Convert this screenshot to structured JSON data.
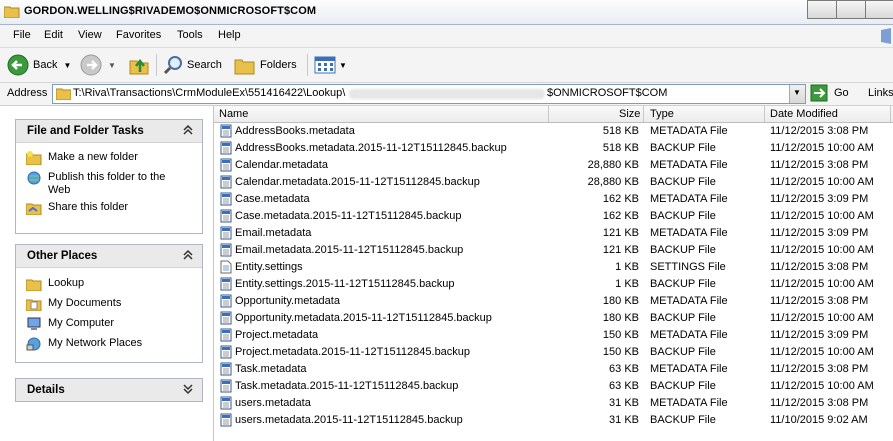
{
  "window": {
    "title": "GORDON.WELLING$RIVADEMO$ONMICROSOFT$COM"
  },
  "menu": [
    "File",
    "Edit",
    "View",
    "Favorites",
    "Tools",
    "Help"
  ],
  "toolbar": {
    "back": "Back",
    "search": "Search",
    "folders": "Folders",
    "go": "Go",
    "links": "Links"
  },
  "address": {
    "label": "Address",
    "path_start": "T:\\Riva\\Transactions\\CrmModuleEx\\551416422\\Lookup\\",
    "path_end": "$ONMICROSOFT$COM"
  },
  "tasks_panel": {
    "title": "File and Folder Tasks",
    "items": [
      "Make a new folder",
      "Publish this folder to the Web",
      "Share this folder"
    ]
  },
  "places_panel": {
    "title": "Other Places",
    "items": [
      "Lookup",
      "My Documents",
      "My Computer",
      "My Network Places"
    ]
  },
  "details_panel": {
    "title": "Details"
  },
  "columns": [
    "Name",
    "Size",
    "Type",
    "Date Modified"
  ],
  "files": [
    {
      "name": "AddressBooks.metadata",
      "size": "518 KB",
      "type": "METADATA File",
      "date": "11/12/2015 3:08 PM"
    },
    {
      "name": "AddressBooks.metadata.2015-11-12T15112845.backup",
      "size": "518 KB",
      "type": "BACKUP File",
      "date": "11/12/2015 10:00 AM"
    },
    {
      "name": "Calendar.metadata",
      "size": "28,880 KB",
      "type": "METADATA File",
      "date": "11/12/2015 3:08 PM"
    },
    {
      "name": "Calendar.metadata.2015-11-12T15112845.backup",
      "size": "28,880 KB",
      "type": "BACKUP File",
      "date": "11/12/2015 10:00 AM"
    },
    {
      "name": "Case.metadata",
      "size": "162 KB",
      "type": "METADATA File",
      "date": "11/12/2015 3:09 PM"
    },
    {
      "name": "Case.metadata.2015-11-12T15112845.backup",
      "size": "162 KB",
      "type": "BACKUP File",
      "date": "11/12/2015 10:00 AM"
    },
    {
      "name": "Email.metadata",
      "size": "121 KB",
      "type": "METADATA File",
      "date": "11/12/2015 3:09 PM"
    },
    {
      "name": "Email.metadata.2015-11-12T15112845.backup",
      "size": "121 KB",
      "type": "BACKUP File",
      "date": "11/12/2015 10:00 AM"
    },
    {
      "name": "Entity.settings",
      "size": "1 KB",
      "type": "SETTINGS File",
      "date": "11/12/2015 3:08 PM"
    },
    {
      "name": "Entity.settings.2015-11-12T15112845.backup",
      "size": "1 KB",
      "type": "BACKUP File",
      "date": "11/12/2015 10:00 AM"
    },
    {
      "name": "Opportunity.metadata",
      "size": "180 KB",
      "type": "METADATA File",
      "date": "11/12/2015 3:08 PM"
    },
    {
      "name": "Opportunity.metadata.2015-11-12T15112845.backup",
      "size": "180 KB",
      "type": "BACKUP File",
      "date": "11/12/2015 10:00 AM"
    },
    {
      "name": "Project.metadata",
      "size": "150 KB",
      "type": "METADATA File",
      "date": "11/12/2015 3:09 PM"
    },
    {
      "name": "Project.metadata.2015-11-12T15112845.backup",
      "size": "150 KB",
      "type": "BACKUP File",
      "date": "11/12/2015 10:00 AM"
    },
    {
      "name": "Task.metadata",
      "size": "63 KB",
      "type": "METADATA File",
      "date": "11/12/2015 3:08 PM"
    },
    {
      "name": "Task.metadata.2015-11-12T15112845.backup",
      "size": "63 KB",
      "type": "BACKUP File",
      "date": "11/12/2015 10:00 AM"
    },
    {
      "name": "users.metadata",
      "size": "31 KB",
      "type": "METADATA File",
      "date": "11/12/2015 3:08 PM"
    },
    {
      "name": "users.metadata.2015-11-12T15112845.backup",
      "size": "31 KB",
      "type": "BACKUP File",
      "date": "11/10/2015 9:02 AM"
    }
  ]
}
